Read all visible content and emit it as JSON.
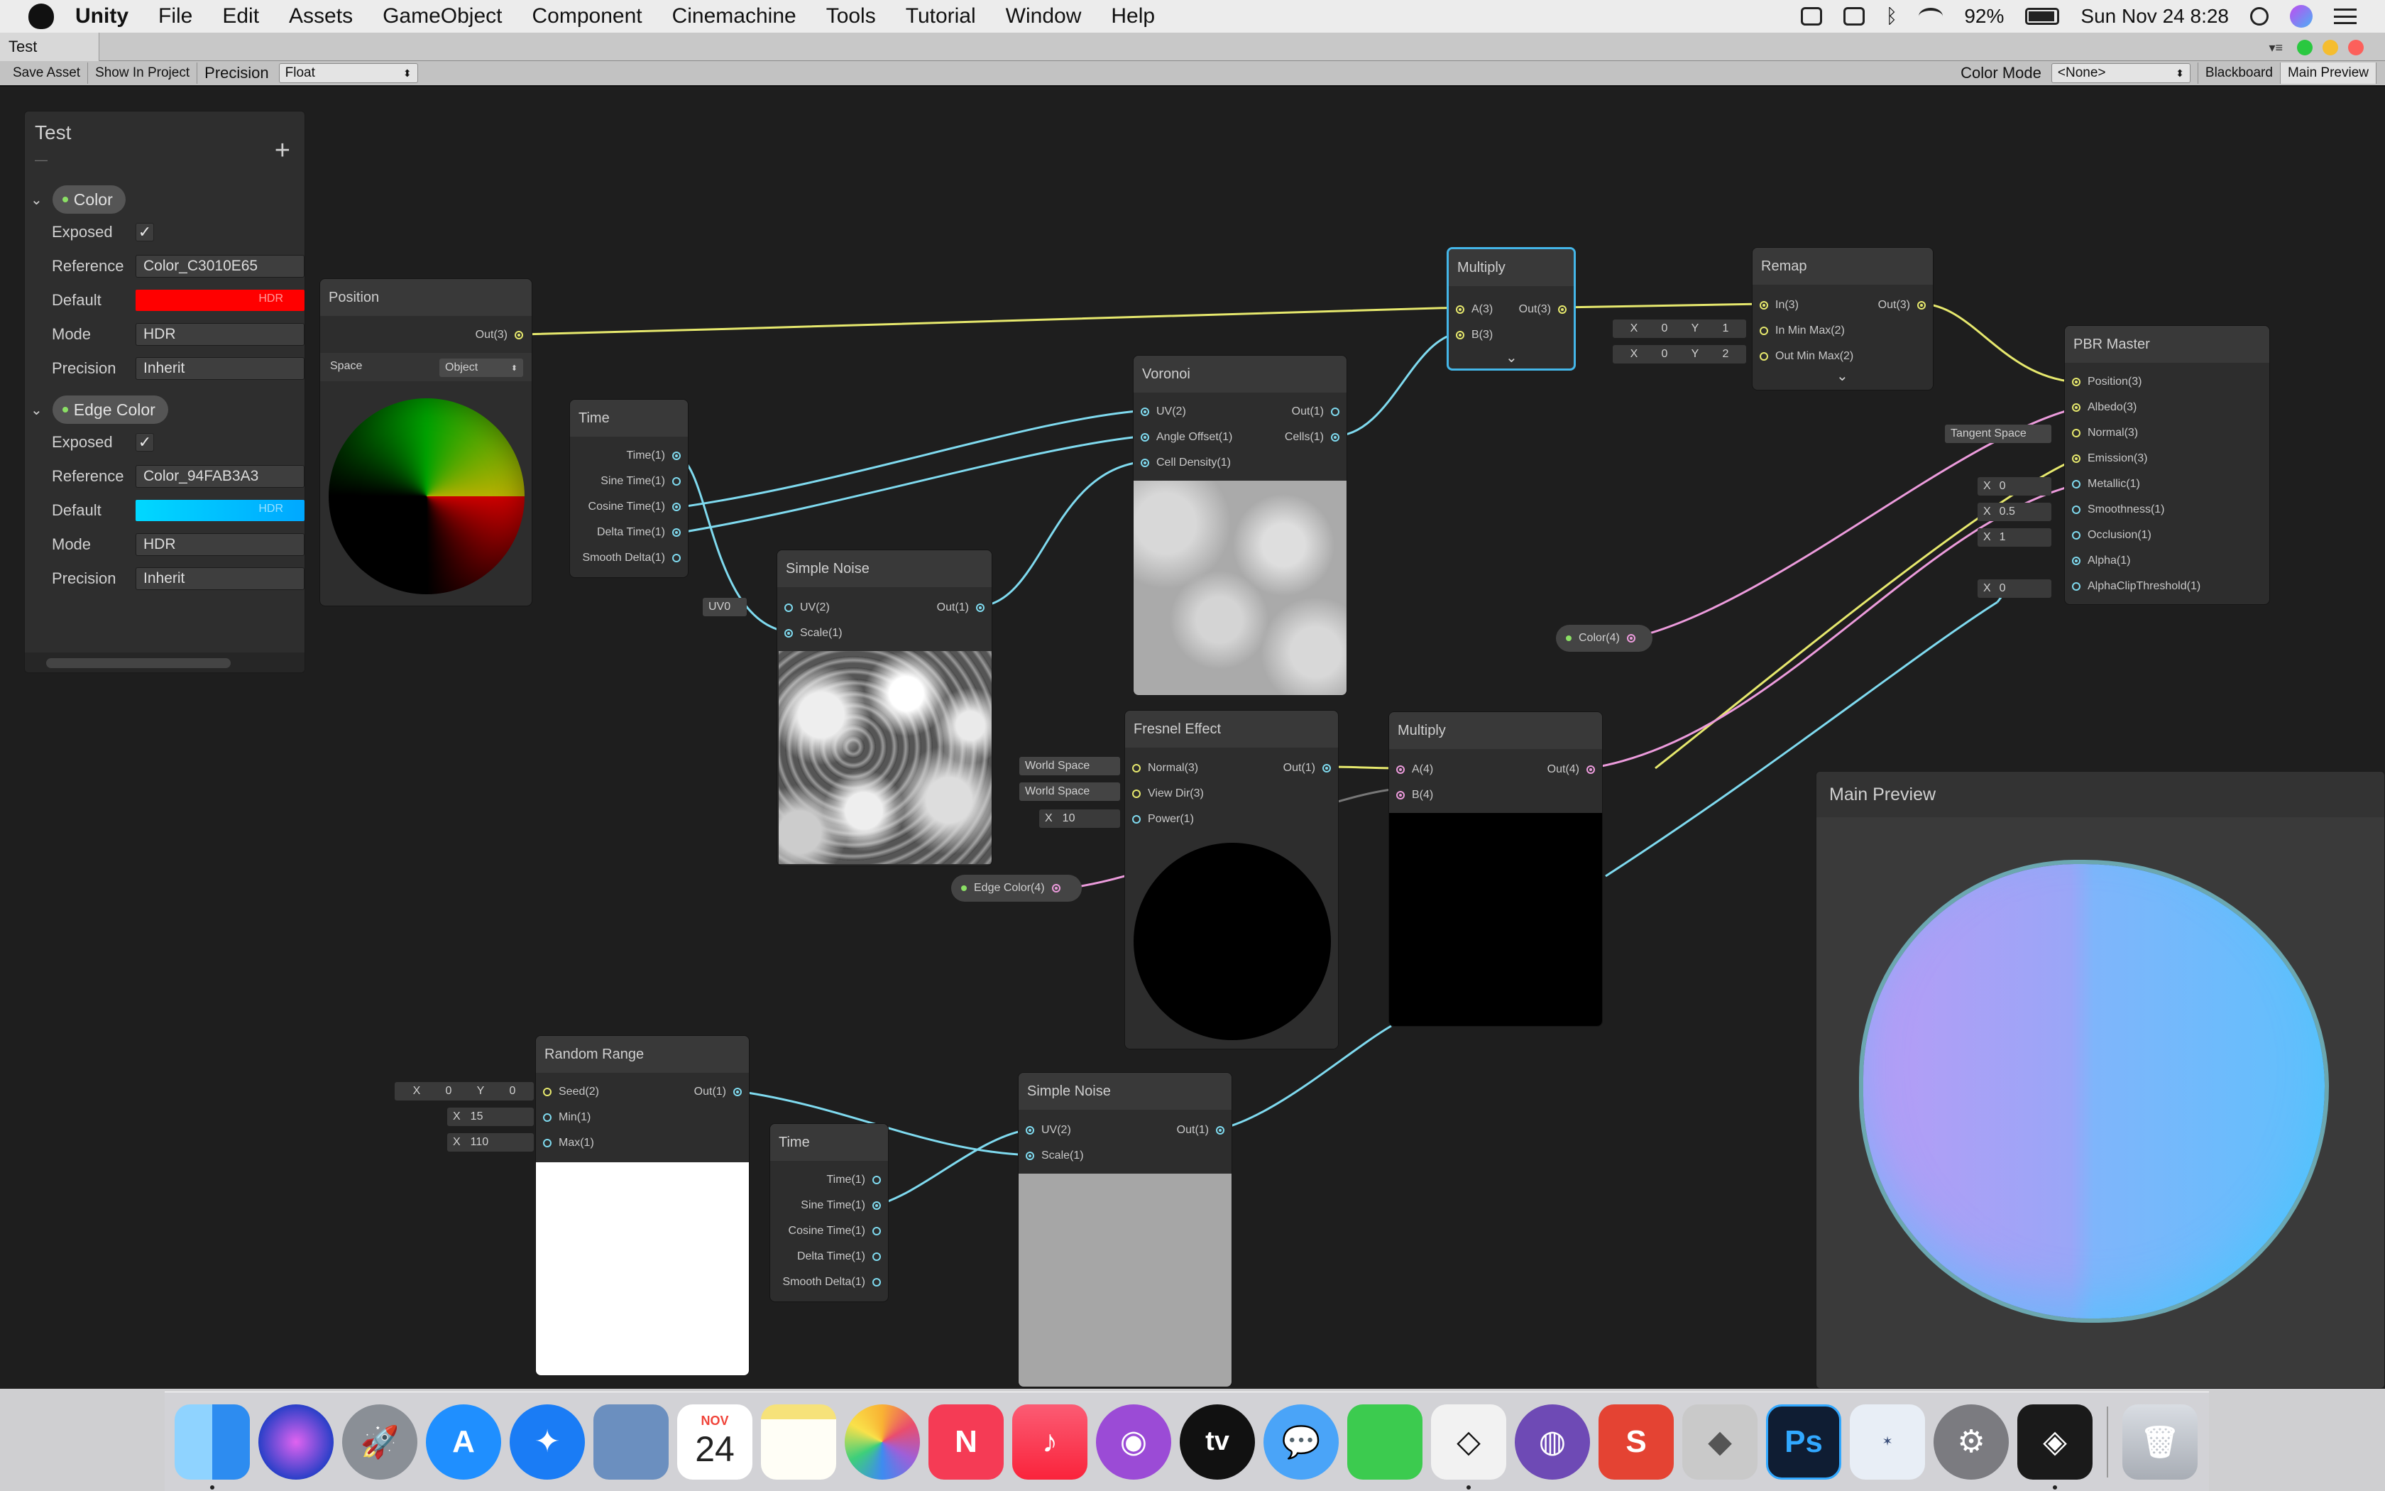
{
  "menubar": {
    "app_name": "Unity",
    "items": [
      "File",
      "Edit",
      "Assets",
      "GameObject",
      "Component",
      "Cinemachine",
      "Tools",
      "Tutorial",
      "Window",
      "Help"
    ],
    "battery": "92%",
    "datetime": "Sun Nov 24  8:28"
  },
  "window": {
    "tab_title": "Test"
  },
  "toolbar": {
    "save_asset": "Save Asset",
    "show_in_project": "Show In Project",
    "precision_label": "Precision",
    "precision_value": "Float",
    "color_mode_label": "Color Mode",
    "color_mode_value": "<None>",
    "blackboard": "Blackboard",
    "main_preview": "Main Preview"
  },
  "blackboard": {
    "title": "Test",
    "subtitle": "—",
    "add": "+",
    "properties": [
      {
        "name": "Color",
        "exposed_label": "Exposed",
        "reference_label": "Reference",
        "reference": "Color_C3010E65",
        "default_label": "Default",
        "default_color": "#ff0000",
        "hdr": "HDR",
        "mode_label": "Mode",
        "mode": "HDR",
        "precision_label": "Precision",
        "precision": "Inherit"
      },
      {
        "name": "Edge Color",
        "exposed_label": "Exposed",
        "reference_label": "Reference",
        "reference": "Color_94FAB3A3",
        "default_label": "Default",
        "default_color": "#00c8ff",
        "hdr": "HDR",
        "mode_label": "Mode",
        "mode": "HDR",
        "precision_label": "Precision",
        "precision": "Inherit"
      }
    ]
  },
  "nodes": {
    "position": {
      "title": "Position",
      "out": "Out(3)",
      "space_label": "Space",
      "space_value": "Object"
    },
    "time1": {
      "title": "Time",
      "outs": [
        "Time(1)",
        "Sine Time(1)",
        "Cosine Time(1)",
        "Delta Time(1)",
        "Smooth Delta(1)"
      ]
    },
    "simple_noise1": {
      "title": "Simple Noise",
      "uv_default": "UV0",
      "ins": [
        "UV(2)",
        "Scale(1)"
      ],
      "out": "Out(1)"
    },
    "voronoi": {
      "title": "Voronoi",
      "ins": [
        "UV(2)",
        "Angle Offset(1)",
        "Cell Density(1)"
      ],
      "outs": [
        "Out(1)",
        "Cells(1)"
      ]
    },
    "multiply1": {
      "title": "Multiply",
      "ins": [
        "A(3)",
        "B(3)"
      ],
      "out": "Out(3)"
    },
    "remap": {
      "title": "Remap",
      "ins": [
        "In(3)",
        "In Min Max(2)",
        "Out Min Max(2)"
      ],
      "out": "Out(3)",
      "in_min_max": [
        "X",
        "0",
        "Y",
        "1"
      ],
      "out_min_max": [
        "X",
        "0",
        "Y",
        "2"
      ]
    },
    "pbr_master": {
      "title": "PBR Master",
      "ins": [
        "Position(3)",
        "Albedo(3)",
        "Normal(3)",
        "Emission(3)",
        "Metallic(1)",
        "Smoothness(1)",
        "Occlusion(1)",
        "Alpha(1)",
        "AlphaClipThreshold(1)"
      ],
      "normal_default": "Tangent Space",
      "metallic_default": [
        "X",
        "0"
      ],
      "smoothness_default": [
        "X",
        "0.5"
      ],
      "occlusion_default": [
        "X",
        "1"
      ],
      "clip_default": [
        "X",
        "0"
      ]
    },
    "color_prop": {
      "label": "Color(4)"
    },
    "fresnel": {
      "title": "Fresnel Effect",
      "ins": [
        "Normal(3)",
        "View Dir(3)",
        "Power(1)"
      ],
      "out": "Out(1)",
      "normal_default": "World Space",
      "viewdir_default": "World Space",
      "power_default": [
        "X",
        "10"
      ]
    },
    "edge_color_prop": {
      "label": "Edge Color(4)"
    },
    "multiply2": {
      "title": "Multiply",
      "ins": [
        "A(4)",
        "B(4)"
      ],
      "out": "Out(4)"
    },
    "random_range": {
      "title": "Random Range",
      "ins": [
        "Seed(2)",
        "Min(1)",
        "Max(1)"
      ],
      "out": "Out(1)",
      "seed_default": [
        "X",
        "0",
        "Y",
        "0"
      ],
      "min_default": [
        "X",
        "15"
      ],
      "max_default": [
        "X",
        "110"
      ]
    },
    "time2": {
      "title": "Time",
      "outs": [
        "Time(1)",
        "Sine Time(1)",
        "Cosine Time(1)",
        "Delta Time(1)",
        "Smooth Delta(1)"
      ]
    },
    "simple_noise2": {
      "title": "Simple Noise",
      "ins": [
        "UV(2)",
        "Scale(1)"
      ],
      "out": "Out(1)"
    }
  },
  "main_preview": {
    "title": "Main Preview"
  },
  "dock": {
    "apps": [
      "finder-icon",
      "siri-icon",
      "launchpad-icon",
      "app-store-icon",
      "safari-icon",
      "preview-icon",
      "calendar-icon",
      "notes-icon",
      "photos-icon",
      "news-icon",
      "music-icon",
      "podcasts-icon",
      "tv-icon",
      "messages-icon",
      "facetime-icon",
      "unity-hub-icon",
      "github-icon",
      "sketchup-icon",
      "roblox-icon",
      "photoshop-icon",
      "ffxiv-icon",
      "system-preferences-icon",
      "unity-icon",
      "trash-icon"
    ],
    "calendar_month": "NOV",
    "calendar_day": "24",
    "tv_label": "tv",
    "photoshop_label": "Ps"
  },
  "colors": {
    "wire_yellow": "#e6e86d",
    "wire_cyan": "#7fdaef",
    "wire_pink": "#ec9bdc",
    "selection": "#44b6e8"
  }
}
